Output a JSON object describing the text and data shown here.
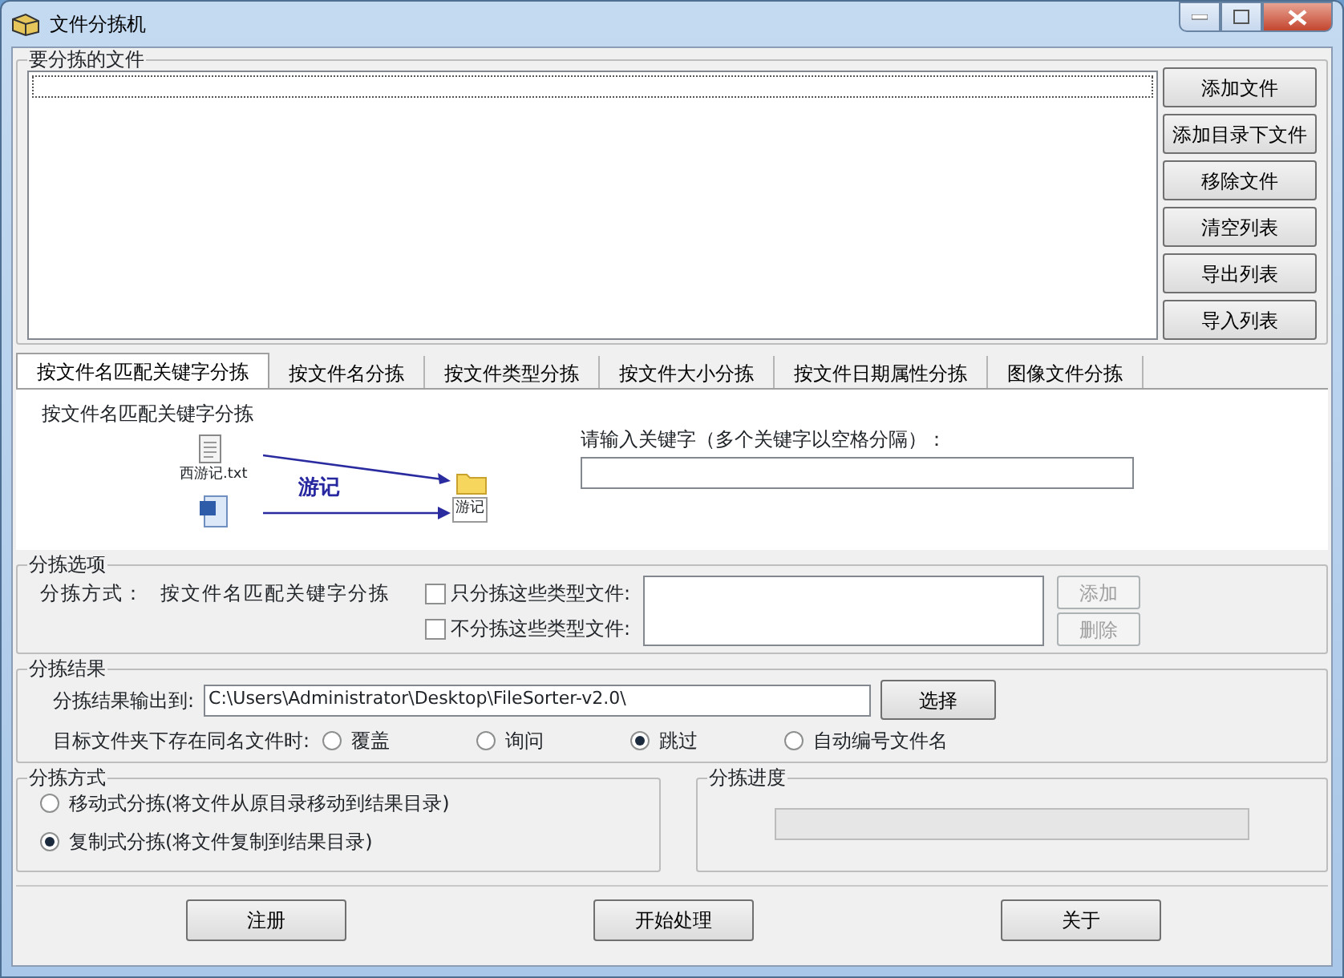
{
  "window": {
    "title": "文件分拣机"
  },
  "files_group": {
    "title": "要分拣的文件",
    "buttons": [
      "添加文件",
      "添加目录下文件",
      "移除文件",
      "清空列表",
      "导出列表",
      "导入列表"
    ]
  },
  "tabs": [
    {
      "label": "按文件名匹配关键字分拣",
      "selected": true
    },
    {
      "label": "按文件名分拣",
      "selected": false
    },
    {
      "label": "按文件类型分拣",
      "selected": false
    },
    {
      "label": "按文件大小分拣",
      "selected": false
    },
    {
      "label": "按文件日期属性分拣",
      "selected": false
    },
    {
      "label": "图像文件分拣",
      "selected": false
    }
  ],
  "tab_panel": {
    "heading": "按文件名匹配关键字分拣",
    "diagram": {
      "file_name": "西游记.txt",
      "keyword": "游记",
      "folder_name": "游记"
    },
    "keyword_label": "请输入关键字（多个关键字以空格分隔）："
  },
  "options": {
    "title": "分拣选项",
    "mode_label": "分拣方式：",
    "mode_value": "按文件名匹配关键字分拣",
    "filters": [
      {
        "label": "只分拣这些类型文件:",
        "checked": false
      },
      {
        "label": "不分拣这些类型文件:",
        "checked": false
      }
    ],
    "buttons": [
      {
        "label": "添加",
        "disabled": true
      },
      {
        "label": "删除",
        "disabled": true
      }
    ]
  },
  "results": {
    "title": "分拣结果",
    "output_label": "分拣结果输出到:",
    "output_path": "C:\\Users\\Administrator\\Desktop\\FileSorter-v2.0\\",
    "browse_button": "选择",
    "conflict_label": "目标文件夹下存在同名文件时:",
    "conflict_options": [
      {
        "label": "覆盖",
        "selected": false
      },
      {
        "label": "询问",
        "selected": false
      },
      {
        "label": "跳过",
        "selected": true
      },
      {
        "label": "自动编号文件名",
        "selected": false
      }
    ]
  },
  "method": {
    "title": "分拣方式",
    "options": [
      {
        "label": "移动式分拣(将文件从原目录移动到结果目录)",
        "selected": false
      },
      {
        "label": "复制式分拣(将文件复制到结果目录)",
        "selected": true
      }
    ]
  },
  "progress": {
    "title": "分拣进度",
    "level": 0
  },
  "footer_buttons": [
    {
      "label": "注册",
      "disabled": false
    },
    {
      "label": "开始处理",
      "disabled": false
    },
    {
      "label": "关于",
      "disabled": false
    }
  ]
}
